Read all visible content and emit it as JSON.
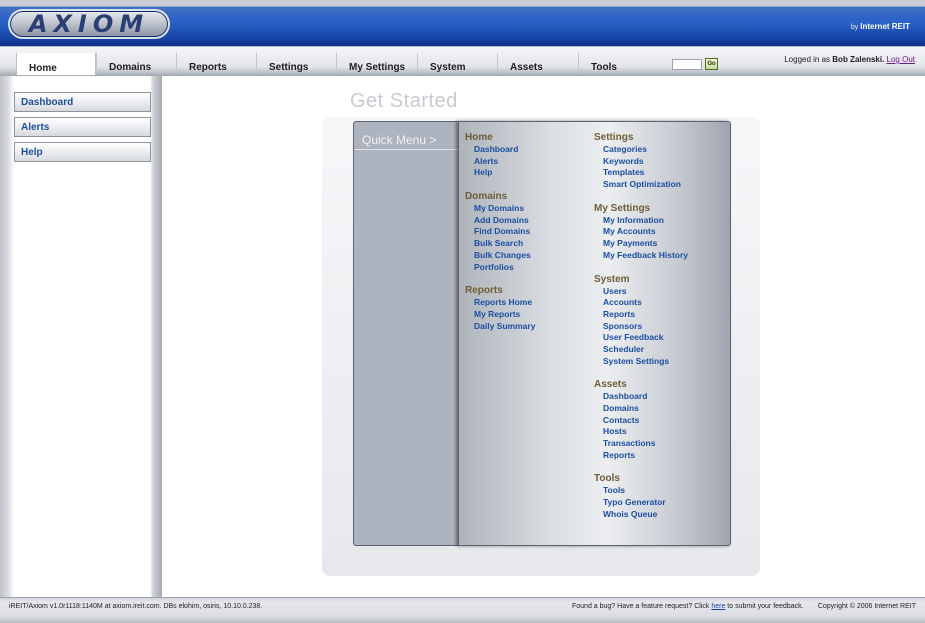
{
  "header": {
    "logo_text": "AXIOM",
    "byline_prefix": "by",
    "byline_brand": "Internet REIT"
  },
  "nav": {
    "tabs": [
      {
        "label": "Home",
        "active": true
      },
      {
        "label": "Domains"
      },
      {
        "label": "Reports"
      },
      {
        "label": "Settings"
      },
      {
        "label": "My Settings"
      },
      {
        "label": "System"
      },
      {
        "label": "Assets"
      },
      {
        "label": "Tools"
      }
    ],
    "search_value": "",
    "go_label": "Go",
    "login_prefix": "Logged in as",
    "user_name": "Bob Zalenski.",
    "logout_label": "Log Out"
  },
  "sidebar": {
    "items": [
      {
        "label": "Dashboard"
      },
      {
        "label": "Alerts"
      },
      {
        "label": "Help"
      }
    ]
  },
  "main": {
    "title": "Get Started",
    "quick_menu_label": "Quick Menu >",
    "col1": [
      {
        "heading": "Home",
        "links": [
          "Dashboard",
          "Alerts",
          "Help"
        ]
      },
      {
        "heading": "Domains",
        "links": [
          "My Domains",
          "Add Domains",
          "Find Domains",
          "Bulk Search",
          "Bulk Changes",
          "Portfolios"
        ]
      },
      {
        "heading": "Reports",
        "links": [
          "Reports Home",
          "My Reports",
          "Daily Summary"
        ]
      }
    ],
    "col2": [
      {
        "heading": "Settings",
        "links": [
          "Categories",
          "Keywords",
          "Templates",
          "Smart Optimization"
        ]
      },
      {
        "heading": "My Settings",
        "links": [
          "My Information",
          "My Accounts",
          "My Payments",
          "My Feedback History"
        ]
      },
      {
        "heading": "System",
        "links": [
          "Users",
          "Accounts",
          "Reports",
          "Sponsors",
          "User Feedback",
          "Scheduler",
          "System Settings"
        ]
      },
      {
        "heading": "Assets",
        "links": [
          "Dashboard",
          "Domains",
          "Contacts",
          "Hosts",
          "Transactions",
          "Reports"
        ]
      },
      {
        "heading": "Tools",
        "links": [
          "Tools",
          "Typo Generator",
          "Whois Queue"
        ]
      }
    ]
  },
  "footer": {
    "left": "iREIT/Axiom v1.0r1118:1140M at axiom.ireit.com. DBs elohim, osiris, 10.10.0.238.",
    "mid_before": "Found a bug? Have a feature request? Click",
    "mid_link": "here",
    "mid_after": "to submit your feedback.",
    "right": "Copyright © 2006 Internet REIT"
  }
}
